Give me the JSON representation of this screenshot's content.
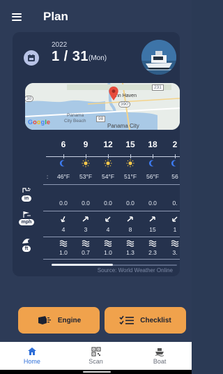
{
  "header": {
    "title": "Plan",
    "menu_icon": "menu-icon"
  },
  "date": {
    "year": "2022",
    "date": "1 / 31",
    "day_of_week": "(Mon)",
    "icon": "calendar-icon"
  },
  "map": {
    "labels": {
      "haven": "nn Haven",
      "panama": "Panama",
      "city_beach": "City Beach",
      "panama_city": "Panama City",
      "road_231": "231",
      "road_390": "390",
      "road_98": "98",
      "road_30": "30"
    },
    "google": [
      "G",
      "o",
      "o",
      "g",
      "l",
      "e"
    ],
    "colors": {
      "pin": "#e74c3c",
      "water": "#a9c9e6"
    }
  },
  "forecast": {
    "hours": [
      "6",
      "9",
      "12",
      "15",
      "18",
      "2"
    ],
    "conditions": [
      "moon",
      "sun",
      "sun",
      "sun",
      "moon",
      "moon"
    ],
    "temperatures": [
      ":",
      "46°F",
      "53°F",
      "54°F",
      "51°F",
      "56°F",
      "56"
    ],
    "precipitation": {
      "unit": "in",
      "values": [
        "0.0",
        "0.0",
        "0.0",
        "0.0",
        "0.0",
        "0."
      ]
    },
    "wind": {
      "unit": "mph",
      "values": [
        "4",
        "3",
        "4",
        "8",
        "15",
        "1"
      ]
    },
    "waves": {
      "unit": "ft",
      "values": [
        "1.0",
        "0.7",
        "1.0",
        "1.3",
        "2.3",
        "3."
      ]
    },
    "source": "Source: World Weather Online",
    "scroll_progress": 0.45
  },
  "buttons": {
    "engine": "Engine",
    "checklist": "Checklist"
  },
  "nav": {
    "home": "Home",
    "scan": "Scan",
    "boat": "Boat",
    "active": "home"
  },
  "colors": {
    "accent": "#f0a24c",
    "background": "#2d3b57",
    "card": "#25324d",
    "nav_active": "#2f6fd8"
  }
}
